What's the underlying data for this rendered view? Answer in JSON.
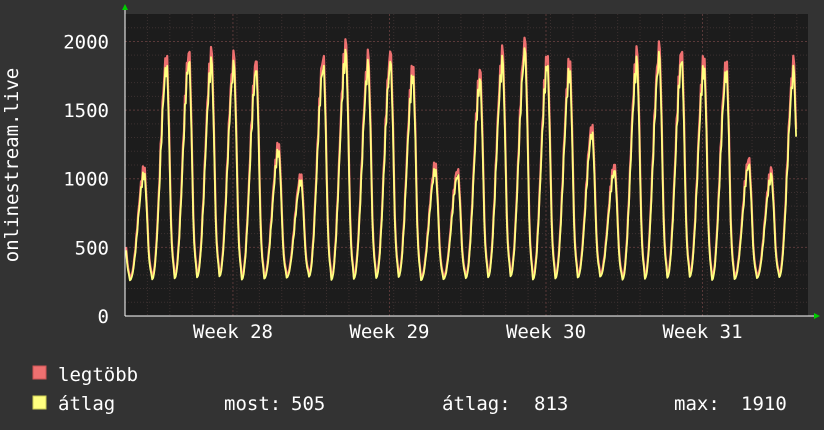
{
  "chart_data": {
    "type": "line",
    "title": "",
    "ylabel": "onlinestream.live",
    "xlabel": "",
    "ylim": [
      0,
      2200
    ],
    "y_ticks": [
      0,
      500,
      1000,
      1500,
      2000
    ],
    "x_ticks": [
      {
        "label": "Week 28",
        "day": 4.82
      },
      {
        "label": "Week 29",
        "day": 11.81
      },
      {
        "label": "Week 30",
        "day": 18.8
      },
      {
        "label": "Week 31",
        "day": 25.79
      }
    ],
    "x_range_days": [
      0,
      30.5
    ],
    "grid": true,
    "legend_position": "bottom-left",
    "colors": {
      "background": "#333333",
      "plot_background": "#1c1c1c",
      "grid": "#4a3a3a",
      "axis": "#ffffff",
      "arrow": "#00cc00",
      "max_series": "#ee7070",
      "avg_series": "#ffff80"
    },
    "daily_peaks": [
      1060,
      1870,
      1900,
      1880,
      1850,
      1830,
      1230,
      1010,
      1870,
      1950,
      1850,
      1880,
      1790,
      1090,
      1050,
      1750,
      1880,
      1960,
      1870,
      1830,
      1370,
      1080,
      1880,
      1920,
      1900,
      1850,
      1830,
      1130,
      1040,
      1810
    ],
    "series": [
      {
        "name": "legtöbb",
        "color": "#ee7070"
      },
      {
        "name": "átlag",
        "color": "#ffff80"
      }
    ],
    "stats": {
      "now_label": "most:",
      "now_value": "505",
      "avg_label": "átlag:",
      "avg_value": "813",
      "max_label": "max:",
      "max_value": "1910"
    }
  }
}
